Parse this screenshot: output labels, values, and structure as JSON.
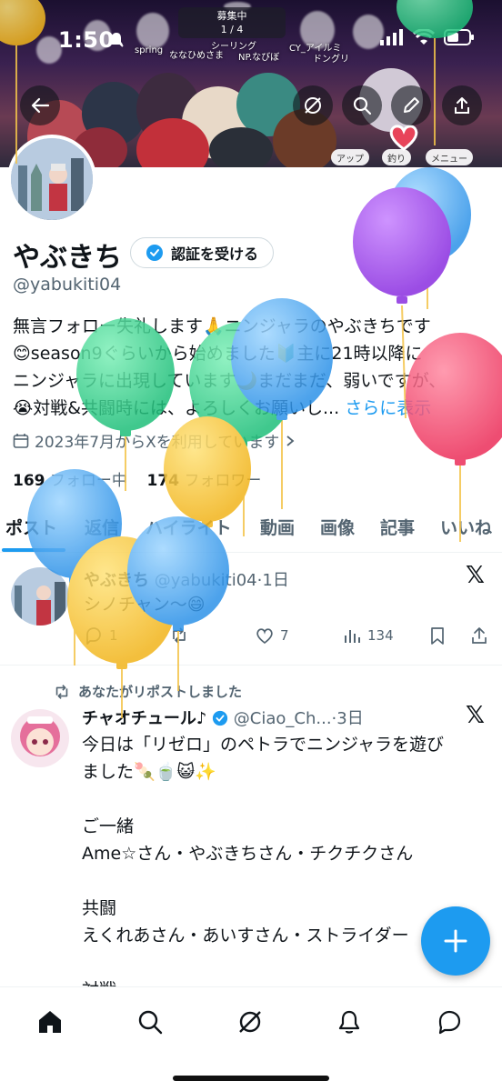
{
  "status_bar": {
    "time": "1:50"
  },
  "banner": {
    "game_status": "募集中",
    "game_count": "1 / 4",
    "player_names": [
      "spring",
      "ななひめさま",
      "シーリング",
      "NP.なびぼ",
      "CY_アイルミ",
      "ドングリ"
    ],
    "game_menu": [
      "アップ",
      "釣り",
      "メニュー"
    ]
  },
  "top_actions": [
    "back-icon",
    "grok-icon",
    "search-icon",
    "edit-icon",
    "share-icon"
  ],
  "profile": {
    "display_name": "やぶきち",
    "verify_label": "認証を受ける",
    "handle": "@yabukiti04",
    "bio_lines": [
      "無言フォロー失礼します🙏ニンジャラのやぶきちです",
      "😊season9ぐらいから始めました🔰主に21時以降に",
      "ニンジャラに出現しています🌙まだまだ、弱いですが、",
      "😭対戦&共闘時には、よろしくお願いし..."
    ],
    "bio_more": "さらに表示",
    "joined": "2023年7月からXを利用しています",
    "following_count": "169",
    "following_label": "フォロー中",
    "followers_count": "174",
    "followers_label": "フォロワー"
  },
  "tabs": [
    "ポスト",
    "返信",
    "ハイライト",
    "動画",
    "画像",
    "記事",
    "いいね"
  ],
  "posts": [
    {
      "name": "やぶきち",
      "handle": "@yabukiti04",
      "time": "1日",
      "text": "シノチャン〜😄",
      "replies": "1",
      "reposts": "",
      "likes": "7",
      "views": "134"
    },
    {
      "repost_label": "あなたがリポストしました",
      "name": "チャオチュール♪",
      "handle": "@Ciao_Ch...",
      "time": "3日",
      "lines": [
        "今日は「リゼロ」のペトラでニンジャラを遊び",
        "ました🍡🍵😺✨",
        "",
        "ご一緒",
        "Ame☆さん・やぶきちさん・チクチクさん",
        "",
        "共闘",
        "えくれあさん・あいすさん・ストライダー",
        "",
        "対戦"
      ]
    }
  ],
  "nav": [
    "home-icon",
    "search-icon",
    "grok-icon",
    "notifications-icon",
    "messages-icon"
  ],
  "colors": {
    "accent": "#1d9bf0",
    "text": "#0f1419",
    "secondary": "#536471"
  }
}
